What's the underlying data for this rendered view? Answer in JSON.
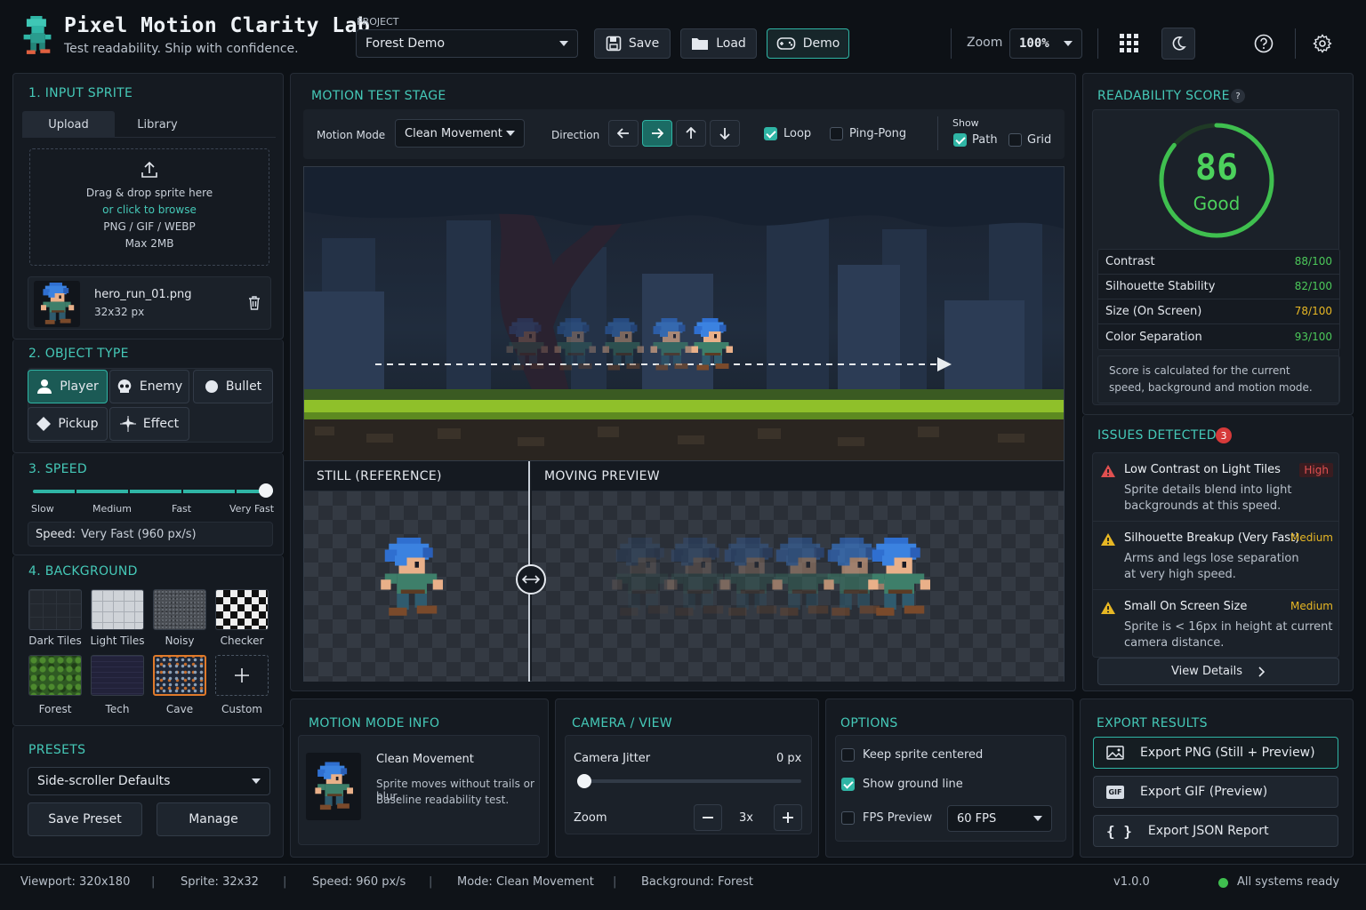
{
  "app": {
    "title": "Pixel Motion Clarity Lab",
    "tagline": "Test readability. Ship with confidence."
  },
  "header": {
    "project_label": "PROJECT",
    "project": "Forest Demo",
    "save": "Save",
    "load": "Load",
    "demo": "Demo",
    "zoom_label": "Zoom",
    "zoom": "100%"
  },
  "input": {
    "title": "1. INPUT SPRITE",
    "tabs": [
      "Upload",
      "Library"
    ],
    "drop1": "Drag & drop sprite here",
    "drop2": "or click to browse",
    "drop3": "PNG / GIF / WEBP",
    "drop4": "Max 2MB",
    "file_name": "hero_run_01.png",
    "file_size": "32x32 px"
  },
  "object": {
    "title": "2. OBJECT TYPE",
    "types": [
      "Player",
      "Enemy",
      "Bullet",
      "Pickup",
      "Effect"
    ]
  },
  "speed": {
    "title": "3. SPEED",
    "labels": [
      "Slow",
      "Medium",
      "Fast",
      "Very Fast"
    ],
    "readout_label": "Speed:",
    "readout": "Very Fast (960 px/s)",
    "value": 1.0
  },
  "background": {
    "title": "4. BACKGROUND",
    "tiles": [
      "Dark Tiles",
      "Light Tiles",
      "Noisy",
      "Checker",
      "Forest",
      "Tech",
      "Cave",
      "Custom"
    ]
  },
  "presets": {
    "title": "PRESETS",
    "selected": "Side-scroller Defaults",
    "save": "Save Preset",
    "manage": "Manage"
  },
  "stage": {
    "title": "MOTION TEST STAGE",
    "mode_label": "Motion Mode",
    "mode": "Clean Movement",
    "direction_label": "Direction",
    "loop": "Loop",
    "pingpong": "Ping-Pong",
    "show_label": "Show",
    "path": "Path",
    "grid": "Grid",
    "still": "STILL (REFERENCE)",
    "moving": "MOVING PREVIEW"
  },
  "score": {
    "title": "READABILITY SCORE",
    "value": 86,
    "grade": "Good",
    "metrics": [
      {
        "name": "Contrast",
        "score": "88",
        "max": "/100",
        "color": "#4cc95a"
      },
      {
        "name": "Silhouette Stability",
        "score": "82",
        "max": "/100",
        "color": "#4cc95a"
      },
      {
        "name": "Size (On Screen)",
        "score": "78",
        "max": "/100",
        "color": "#e7b724"
      },
      {
        "name": "Color Separation",
        "score": "93",
        "max": "/100",
        "color": "#4cc95a"
      }
    ],
    "note": "Score is calculated for the current speed, background and motion mode."
  },
  "issues": {
    "title": "ISSUES DETECTED",
    "count": "3",
    "list": [
      {
        "title": "Low Contrast on Light Tiles",
        "severity": "High",
        "desc1": "Sprite details blend into light",
        "desc2": "backgrounds at this speed."
      },
      {
        "title": "Silhouette Breakup (Very Fast)",
        "severity": "Medium",
        "desc1": "Arms and legs lose separation",
        "desc2": "at very high speed."
      },
      {
        "title": "Small On Screen Size",
        "severity": "Medium",
        "desc1": "Sprite is < 16px in height at current",
        "desc2": "camera distance."
      }
    ],
    "view": "View Details"
  },
  "modeinfo": {
    "title": "MOTION MODE INFO",
    "name": "Clean Movement",
    "desc1": "Sprite moves without trails or blur.",
    "desc2": "Baseline readability test."
  },
  "camera": {
    "title": "CAMERA / VIEW",
    "jitter_label": "Camera Jitter",
    "jitter": "0 px",
    "zoom_label": "Zoom",
    "zoom": "3x"
  },
  "options": {
    "title": "OPTIONS",
    "centered": "Keep sprite centered",
    "ground": "Show ground line",
    "fps_label": "FPS Preview",
    "fps": "60 FPS"
  },
  "export": {
    "title": "EXPORT RESULTS",
    "png": "Export PNG (Still + Preview)",
    "gif": "Export GIF (Preview)",
    "json": "Export JSON Report"
  },
  "status": {
    "viewport_label": "Viewport:",
    "viewport": "320x180",
    "sprite_label": "Sprite:",
    "sprite": "32x32",
    "speed_label": "Speed:",
    "speed": "960 px/s",
    "mode_label": "Mode:",
    "mode": "Clean Movement",
    "bg_label": "Background:",
    "bg": "Forest",
    "version": "v1.0.0",
    "ready": "All systems ready"
  }
}
